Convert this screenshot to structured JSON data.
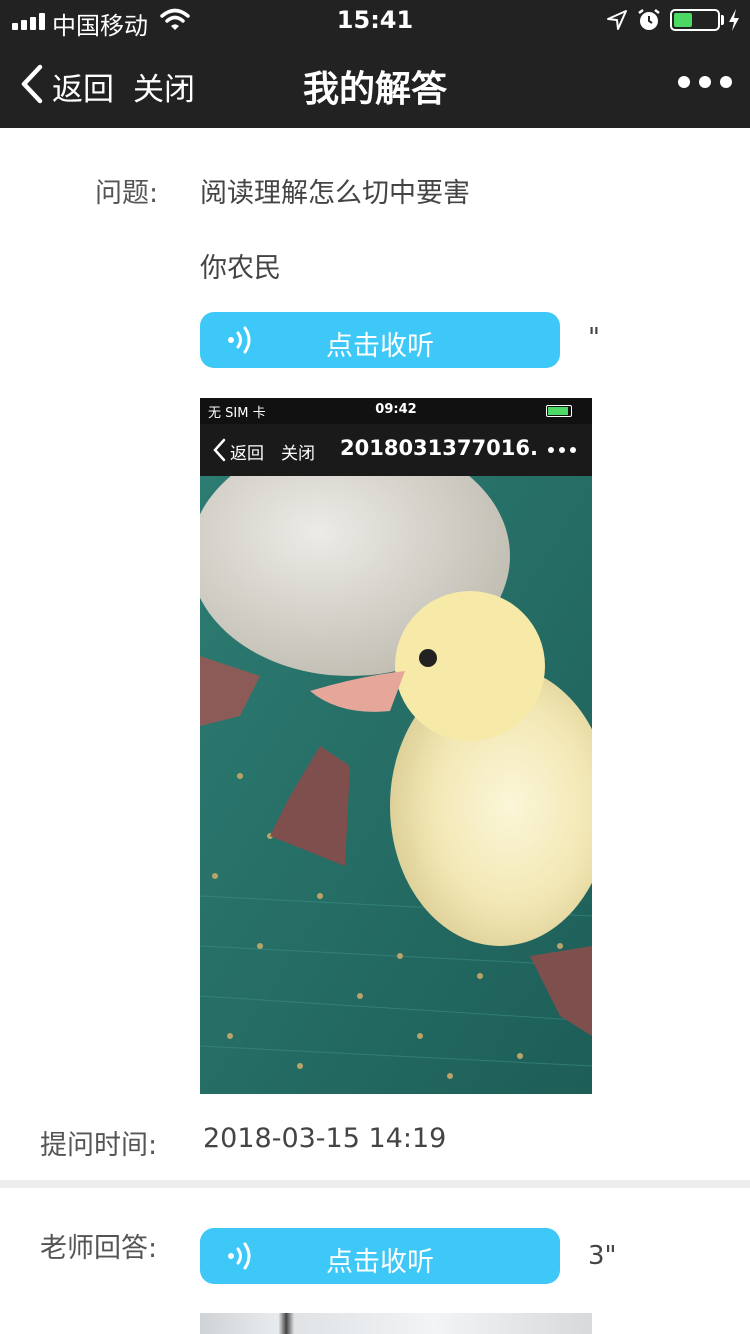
{
  "status_bar": {
    "carrier": "中国移动",
    "time": "15:41",
    "battery_level_fraction": 0.4
  },
  "nav": {
    "back_label": "返回",
    "close_label": "关闭",
    "title": "我的解答"
  },
  "question": {
    "label": "问题:",
    "title": "阅读理解怎么切中要害",
    "body": "你农民",
    "listen_label": "点击收听",
    "duration": "\"",
    "screenshot": {
      "status_left": "无 SIM 卡",
      "status_time": "09:42",
      "back_label": "返回",
      "close_label": "关闭",
      "title": "2018031377016..."
    }
  },
  "ask_time": {
    "label": "提问时间:",
    "value": "2018-03-15 14:19"
  },
  "teacher_answer": {
    "label": "老师回答:",
    "listen_label": "点击收听",
    "duration": "3\""
  },
  "colors": {
    "nav_bg": "#222222",
    "listen_button": "#3ec8f7",
    "battery_fill": "#4cd964"
  },
  "icons": [
    "back-chevron-icon",
    "more-icon",
    "wifi-icon",
    "location-icon",
    "alarm-icon",
    "battery-icon",
    "sound-wave-icon"
  ]
}
